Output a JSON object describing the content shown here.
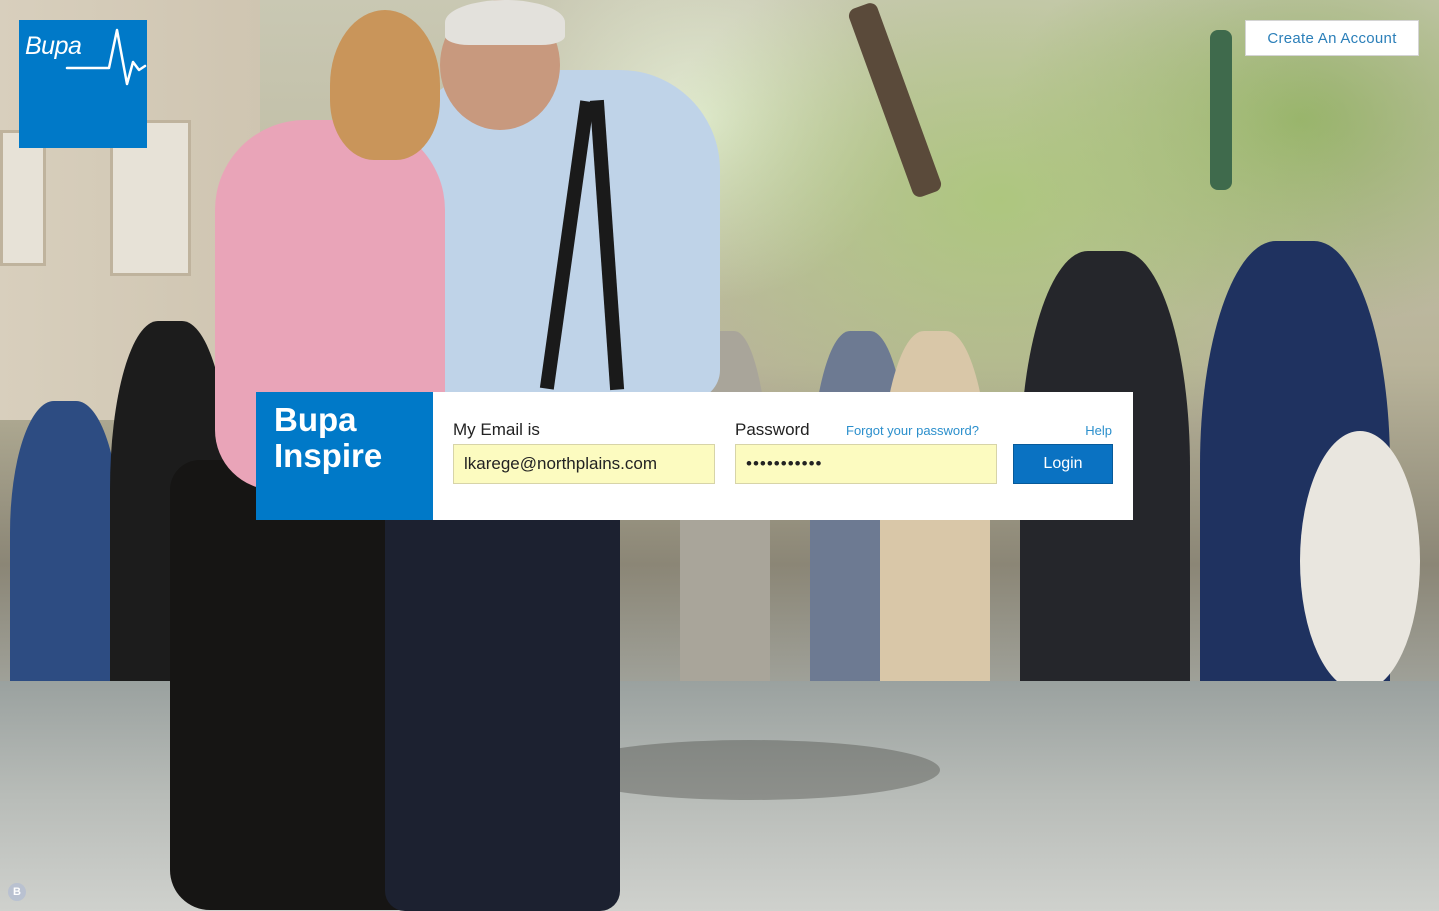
{
  "brand": {
    "logo_text": "Bupa",
    "logo_color": "#0079c8"
  },
  "header": {
    "create_account_label": "Create An Account"
  },
  "login": {
    "brand_line1": "Bupa",
    "brand_line2": "Inspire",
    "email_label": "My Email is",
    "email_value": "lkarege@northplains.com",
    "password_label": "Password",
    "password_value": "•••••••••••",
    "forgot_label": "Forgot your password?",
    "help_label": "Help",
    "login_label": "Login",
    "accent_color": "#0a72c2",
    "input_bg": "#fcfbc0"
  },
  "footer": {
    "badge_text": "B"
  },
  "background": {
    "description_icon": "photo-background"
  }
}
